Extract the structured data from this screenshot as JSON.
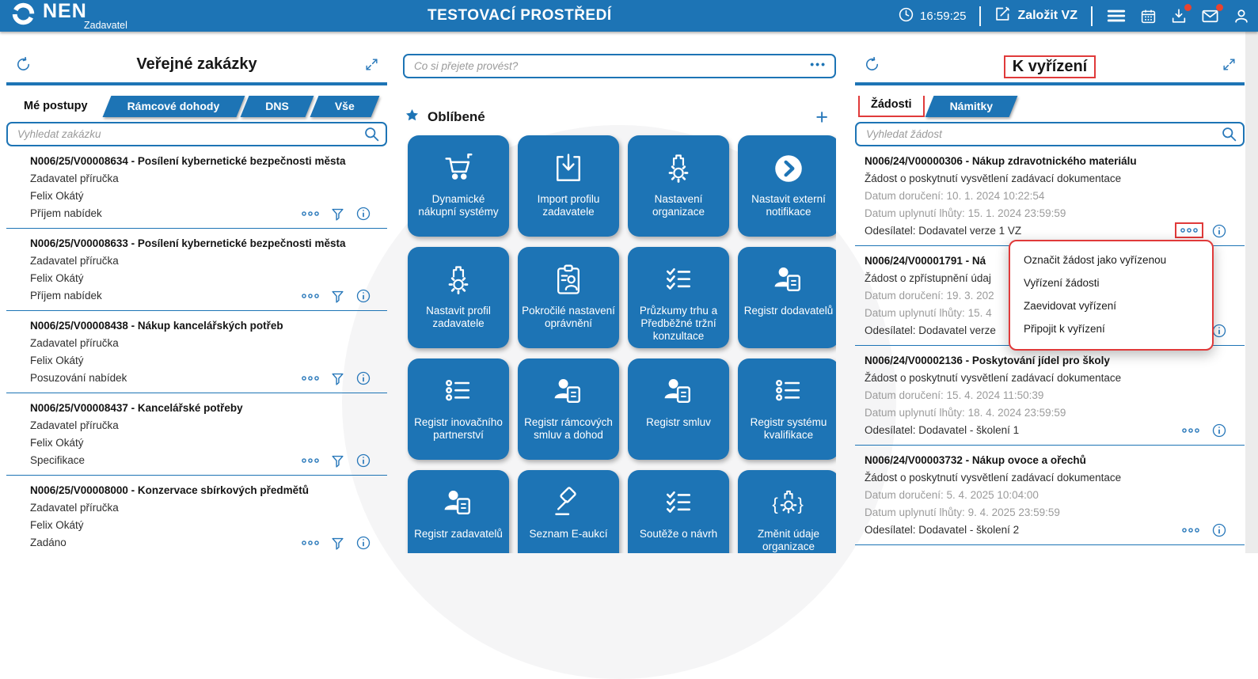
{
  "topbar": {
    "brand": "NEN",
    "brand_sub": "Zadavatel",
    "environment_title": "TESTOVACÍ PROSTŘEDÍ",
    "time": "16:59:25",
    "create_vz_label": "Založit VZ",
    "icons": [
      "clock-icon",
      "edit-icon",
      "menu-icon",
      "calendar-icon",
      "inbox-icon",
      "mail-icon",
      "user-icon"
    ],
    "badges": {
      "inbox": true,
      "mail": true
    }
  },
  "colors": {
    "primary_blue": "#1d74b5",
    "accent_blue": "#2878ba",
    "annotation_red": "#e03a3a",
    "badge_red": "#e8432f",
    "gray_text": "#9b9b9b"
  },
  "left_panel": {
    "title": "Veřejné zakázky",
    "tabs": [
      {
        "label": "Mé postupy",
        "active": true
      },
      {
        "label": "Rámcové dohody",
        "active": false
      },
      {
        "label": "DNS",
        "active": false
      },
      {
        "label": "Vše",
        "active": false
      }
    ],
    "search_placeholder": "Vyhledat zakázku",
    "items": [
      {
        "title": "N006/25/V00008634 - Posílení kybernetické bezpečnosti města",
        "line2": "Zadavatel příručka",
        "line3": "Felix Okátý",
        "status": "Příjem nabídek"
      },
      {
        "title": "N006/25/V00008633 - Posílení kybernetické bezpečnosti města",
        "line2": "Zadavatel příručka",
        "line3": "Felix Okátý",
        "status": "Příjem nabídek"
      },
      {
        "title": "N006/25/V00008438 - Nákup kancelářských potřeb",
        "line2": "Zadavatel příručka",
        "line3": "Felix Okátý",
        "status": "Posuzování nabídek"
      },
      {
        "title": "N006/25/V00008437 - Kancelářské potřeby",
        "line2": "Zadavatel příručka",
        "line3": "Felix Okátý",
        "status": "Specifikace"
      },
      {
        "title": "N006/25/V00008000 - Konzervace sbírkových předmětů",
        "line2": "Zadavatel příručka",
        "line3": "Felix Okátý",
        "status": "Zadáno"
      }
    ]
  },
  "center": {
    "search_placeholder": "Co si přejete provést?",
    "search_more": "•••",
    "favorites_title": "Oblíbené",
    "add_label": "+",
    "tiles": [
      {
        "label": "Dynamické nákupní systémy",
        "icon": "cart-icon"
      },
      {
        "label": "Import profilu zadavatele",
        "icon": "import-icon"
      },
      {
        "label": "Nastavení organizace",
        "icon": "organization-gear-icon"
      },
      {
        "label": "Nastavit externí notifikace",
        "icon": "chevron-circle-icon"
      },
      {
        "label": "Nastavit profil zadavatele",
        "icon": "organization-gear-icon"
      },
      {
        "label": "Pokročilé nastavení oprávnění",
        "icon": "clipboard-person-icon"
      },
      {
        "label": "Průzkumy trhu a Předběžné tržní konzultace",
        "icon": "checklist-icon"
      },
      {
        "label": "Registr dodavatelů",
        "icon": "person-card-icon"
      },
      {
        "label": "Registr inovačního partnerství",
        "icon": "bullet-list-icon"
      },
      {
        "label": "Registr rámcových smluv a dohod",
        "icon": "person-card-icon"
      },
      {
        "label": "Registr smluv",
        "icon": "person-card-icon"
      },
      {
        "label": "Registr systému kvalifikace",
        "icon": "bullet-list-icon"
      },
      {
        "label": "Registr zadavatelů",
        "icon": "person-card-icon"
      },
      {
        "label": "Seznam E-aukcí",
        "icon": "gavel-icon"
      },
      {
        "label": "Soutěže o návrh",
        "icon": "checklist-icon"
      },
      {
        "label": "Změnit údaje organizace",
        "icon": "organization-braces-icon"
      }
    ]
  },
  "right_panel": {
    "title": "K vyřízení",
    "tabs": [
      {
        "label": "Žádosti",
        "active": true
      },
      {
        "label": "Námitky",
        "active": false
      }
    ],
    "search_placeholder": "Vyhledat žádost",
    "items": [
      {
        "title": "N006/24/V00000306 - Nákup zdravotnického materiálu",
        "type": "Žádost o poskytnutí vysvětlení zadávací dokumentace",
        "received": "Datum doručení: 10. 1. 2024 10:22:54",
        "deadline": "Datum uplynutí lhůty: 15. 1. 2024 23:59:59",
        "sender": "Odesílatel: Dodavatel verze 1 VZ"
      },
      {
        "title": "N006/24/V00001791 - Ná",
        "type": "Žádost o zpřístupnění údaj",
        "received": "Datum doručení: 19. 3. 202",
        "deadline": "Datum uplynutí lhůty: 15. 4",
        "sender": "Odesílatel: Dodavatel verze"
      },
      {
        "title": "N006/24/V00002136 - Poskytování jídel pro školy",
        "type": "Žádost o poskytnutí vysvětlení zadávací dokumentace",
        "received": "Datum doručení: 15. 4. 2024 11:50:39",
        "deadline": "Datum uplynutí lhůty: 18. 4. 2024 23:59:59",
        "sender": "Odesílatel: Dodavatel - školení 1"
      },
      {
        "title": "N006/24/V00003732 - Nákup ovoce a ořechů",
        "type": "Žádost o poskytnutí vysvětlení zadávací dokumentace",
        "received": "Datum doručení: 5. 4. 2025 10:04:00",
        "deadline": "Datum uplynutí lhůty: 9. 4. 2025 23:59:59",
        "sender": "Odesílatel: Dodavatel - školení 2"
      }
    ],
    "context_menu": {
      "items": [
        "Označit žádost jako vyřízenou",
        "Vyřízení žádosti",
        "Zaevidovat vyřízení",
        "Připojit k vyřízení"
      ]
    }
  },
  "annotations": {
    "highlight_color": "#e03a3a",
    "highlighted": [
      "panel-title-k-vyrizeni",
      "tab-zadosti",
      "item-1-more-button",
      "context-menu"
    ]
  }
}
